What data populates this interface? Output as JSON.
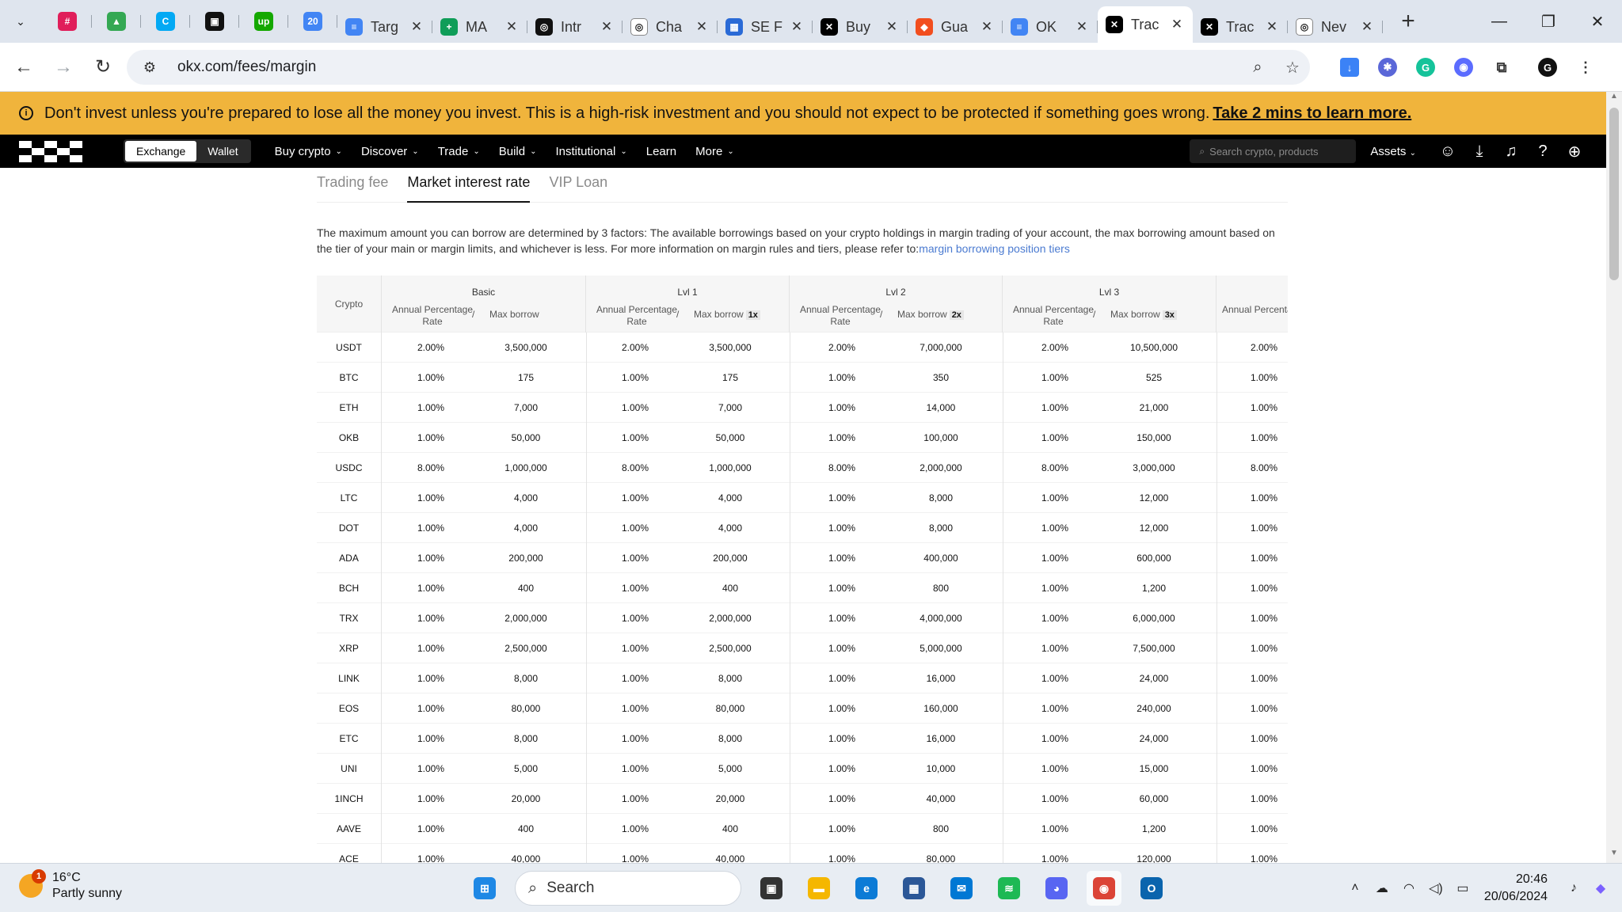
{
  "browser": {
    "tabs": [
      {
        "title": "Targ",
        "color": "#4285f4",
        "glyph": "≡"
      },
      {
        "title": "MA",
        "color": "#0f9d58",
        "glyph": "+"
      },
      {
        "title": "Intr",
        "color": "#111111",
        "glyph": "◎"
      },
      {
        "title": "Cha",
        "color": "#ffffff",
        "glyph": "◎"
      },
      {
        "title": "SE F",
        "color": "#2a6ad6",
        "glyph": "▦"
      },
      {
        "title": "Buy",
        "color": "#000000",
        "glyph": "✕"
      },
      {
        "title": "Gua",
        "color": "#f24e1e",
        "glyph": "◆"
      },
      {
        "title": "OK",
        "color": "#4285f4",
        "glyph": "≡"
      },
      {
        "title": "Trac",
        "color": "#000000",
        "glyph": "✕",
        "active": true
      },
      {
        "title": "Trac",
        "color": "#000000",
        "glyph": "✕"
      },
      {
        "title": "Nev",
        "color": "#ffffff",
        "glyph": "◎"
      }
    ],
    "pinned": [
      {
        "name": "slack-icon",
        "color": "#e01e5a",
        "glyph": "#"
      },
      {
        "name": "google-drive-icon",
        "color": "#34a853",
        "glyph": "▲"
      },
      {
        "name": "clockify-icon",
        "color": "#03a9f4",
        "glyph": "C"
      },
      {
        "name": "pinned-app-icon",
        "color": "#111111",
        "glyph": "▣"
      },
      {
        "name": "upwork-icon",
        "color": "#14a800",
        "glyph": "up"
      },
      {
        "name": "calendar-icon",
        "color": "#4285f4",
        "glyph": "20"
      }
    ],
    "url": "okx.com/fees/margin"
  },
  "banner": {
    "text": "Don't invest unless you're prepared to lose all the money you invest. This is a high-risk investment and you should not expect to be protected if something goes wrong.",
    "link": "Take 2 mins to learn more."
  },
  "site_nav": {
    "seg": [
      "Exchange",
      "Wallet"
    ],
    "menu": [
      "Buy crypto",
      "Discover",
      "Trade",
      "Build",
      "Institutional",
      "Learn",
      "More"
    ],
    "menu_has_chevron": [
      true,
      true,
      true,
      true,
      true,
      false,
      true
    ],
    "search_placeholder": "Search crypto, products",
    "assets": "Assets"
  },
  "subtabs": [
    "Trading fee",
    "Market interest rate",
    "VIP Loan"
  ],
  "description": {
    "text": "The maximum amount you can borrow are determined by 3 factors: The available borrowings based on your crypto holdings in margin trading of your account, the max borrowing amount based on the tier of your main or margin limits, and whichever is less. For more information on margin rules and tiers, please refer to:",
    "link": "margin borrowing position tiers"
  },
  "table": {
    "crypto_header": "Crypto",
    "tiers": [
      {
        "name": "Basic",
        "apr": "Annual Percentage Rate",
        "max": "Max borrow",
        "mult": ""
      },
      {
        "name": "Lvl 1",
        "apr": "Annual Percentage Rate",
        "max": "Max borrow",
        "mult": "1x"
      },
      {
        "name": "Lvl 2",
        "apr": "Annual Percentage Rate",
        "max": "Max borrow",
        "mult": "2x"
      },
      {
        "name": "Lvl 3",
        "apr": "Annual Percentage Rate",
        "max": "Max borrow",
        "mult": "3x"
      },
      {
        "name": "",
        "apr": "Annual Percentage R",
        "max": "",
        "mult": ""
      }
    ],
    "rows": [
      [
        "USDT",
        "2.00%",
        "3,500,000",
        "2.00%",
        "3,500,000",
        "2.00%",
        "7,000,000",
        "2.00%",
        "10,500,000",
        "2.00%"
      ],
      [
        "BTC",
        "1.00%",
        "175",
        "1.00%",
        "175",
        "1.00%",
        "350",
        "1.00%",
        "525",
        "1.00%"
      ],
      [
        "ETH",
        "1.00%",
        "7,000",
        "1.00%",
        "7,000",
        "1.00%",
        "14,000",
        "1.00%",
        "21,000",
        "1.00%"
      ],
      [
        "OKB",
        "1.00%",
        "50,000",
        "1.00%",
        "50,000",
        "1.00%",
        "100,000",
        "1.00%",
        "150,000",
        "1.00%"
      ],
      [
        "USDC",
        "8.00%",
        "1,000,000",
        "8.00%",
        "1,000,000",
        "8.00%",
        "2,000,000",
        "8.00%",
        "3,000,000",
        "8.00%"
      ],
      [
        "LTC",
        "1.00%",
        "4,000",
        "1.00%",
        "4,000",
        "1.00%",
        "8,000",
        "1.00%",
        "12,000",
        "1.00%"
      ],
      [
        "DOT",
        "1.00%",
        "4,000",
        "1.00%",
        "4,000",
        "1.00%",
        "8,000",
        "1.00%",
        "12,000",
        "1.00%"
      ],
      [
        "ADA",
        "1.00%",
        "200,000",
        "1.00%",
        "200,000",
        "1.00%",
        "400,000",
        "1.00%",
        "600,000",
        "1.00%"
      ],
      [
        "BCH",
        "1.00%",
        "400",
        "1.00%",
        "400",
        "1.00%",
        "800",
        "1.00%",
        "1,200",
        "1.00%"
      ],
      [
        "TRX",
        "1.00%",
        "2,000,000",
        "1.00%",
        "2,000,000",
        "1.00%",
        "4,000,000",
        "1.00%",
        "6,000,000",
        "1.00%"
      ],
      [
        "XRP",
        "1.00%",
        "2,500,000",
        "1.00%",
        "2,500,000",
        "1.00%",
        "5,000,000",
        "1.00%",
        "7,500,000",
        "1.00%"
      ],
      [
        "LINK",
        "1.00%",
        "8,000",
        "1.00%",
        "8,000",
        "1.00%",
        "16,000",
        "1.00%",
        "24,000",
        "1.00%"
      ],
      [
        "EOS",
        "1.00%",
        "80,000",
        "1.00%",
        "80,000",
        "1.00%",
        "160,000",
        "1.00%",
        "240,000",
        "1.00%"
      ],
      [
        "ETC",
        "1.00%",
        "8,000",
        "1.00%",
        "8,000",
        "1.00%",
        "16,000",
        "1.00%",
        "24,000",
        "1.00%"
      ],
      [
        "UNI",
        "1.00%",
        "5,000",
        "1.00%",
        "5,000",
        "1.00%",
        "10,000",
        "1.00%",
        "15,000",
        "1.00%"
      ],
      [
        "1INCH",
        "1.00%",
        "20,000",
        "1.00%",
        "20,000",
        "1.00%",
        "40,000",
        "1.00%",
        "60,000",
        "1.00%"
      ],
      [
        "AAVE",
        "1.00%",
        "400",
        "1.00%",
        "400",
        "1.00%",
        "800",
        "1.00%",
        "1,200",
        "1.00%"
      ],
      [
        "ACE",
        "1.00%",
        "40,000",
        "1.00%",
        "40,000",
        "1.00%",
        "80,000",
        "1.00%",
        "120,000",
        "1.00%"
      ]
    ]
  },
  "taskbar": {
    "temp": "16°C",
    "condition": "Partly sunny",
    "weather_badge": "1",
    "search": "Search",
    "time": "20:46",
    "date": "20/06/2024",
    "apps": [
      {
        "name": "windows-start-icon",
        "color": "#1e88e5",
        "glyph": "⊞"
      },
      {
        "name": "task-view-icon",
        "color": "#333333",
        "glyph": "▣"
      },
      {
        "name": "file-explorer-icon",
        "color": "#f5b700",
        "glyph": "▬"
      },
      {
        "name": "edge-icon",
        "color": "#0c7bd6",
        "glyph": "e"
      },
      {
        "name": "store-icon",
        "color": "#2b5797",
        "glyph": "▦"
      },
      {
        "name": "mail-icon",
        "color": "#0078d4",
        "glyph": "✉"
      },
      {
        "name": "spotify-icon",
        "color": "#1db954",
        "glyph": "≋"
      },
      {
        "name": "discord-icon",
        "color": "#5865f2",
        "glyph": "◕"
      },
      {
        "name": "chrome-icon",
        "color": "#db4437",
        "glyph": "◉"
      },
      {
        "name": "outlook-icon",
        "color": "#0a64ad",
        "glyph": "O"
      }
    ]
  }
}
